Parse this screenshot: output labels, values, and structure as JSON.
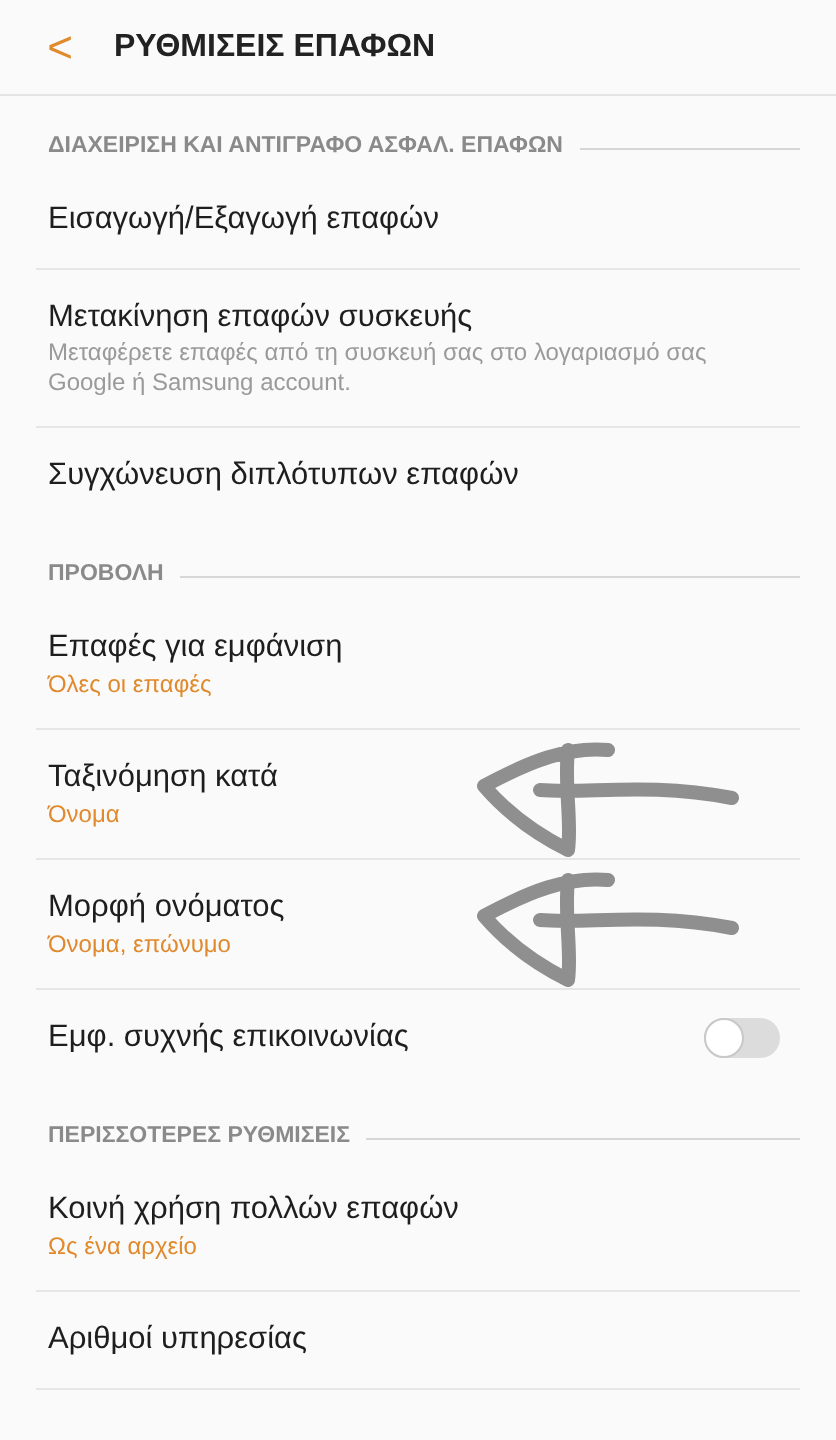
{
  "header": {
    "back": "<",
    "title": "ΡΥΘΜΙΣΕΙΣ ΕΠΑΦΩΝ"
  },
  "sections": [
    {
      "title": "ΔΙΑΧΕΙΡΙΣΗ ΚΑΙ ΑΝΤΙΓΡΑΦΟ ΑΣΦΑΛ. ΕΠΑΦΩΝ",
      "items": [
        {
          "kind": "link",
          "title": "Εισαγωγή/Εξαγωγή επαφών",
          "marked": false
        },
        {
          "kind": "link",
          "title": "Μετακίνηση επαφών συσκευής",
          "description": "Μεταφέρετε επαφές από τη συσκευή σας στο λογαριασμό σας Google ή Samsung account.",
          "marked": false
        },
        {
          "kind": "link",
          "title": "Συγχώνευση διπλότυπων επαφών",
          "marked": false
        }
      ]
    },
    {
      "title": "ΠΡΟΒΟΛΗ",
      "items": [
        {
          "kind": "link",
          "title": "Επαφές για εμφάνιση",
          "value": "Όλες οι επαφές",
          "marked": false
        },
        {
          "kind": "link",
          "title": "Ταξινόμηση κατά",
          "value": "Όνομα",
          "marked": true
        },
        {
          "kind": "link",
          "title": "Μορφή ονόματος",
          "value": "Όνομα, επώνυμο",
          "marked": true
        },
        {
          "kind": "toggle",
          "title": "Εμφ. συχνής επικοινωνίας",
          "on": false,
          "marked": false
        }
      ]
    },
    {
      "title": "ΠΕΡΙΣΣΟΤΕΡΕΣ ΡΥΘΜΙΣΕΙΣ",
      "items": [
        {
          "kind": "link",
          "title": "Κοινή χρήση πολλών επαφών",
          "value": "Ως ένα αρχείο",
          "marked": false
        },
        {
          "kind": "link",
          "title": "Αριθμοί υπηρεσίας",
          "marked": false
        }
      ]
    }
  ]
}
